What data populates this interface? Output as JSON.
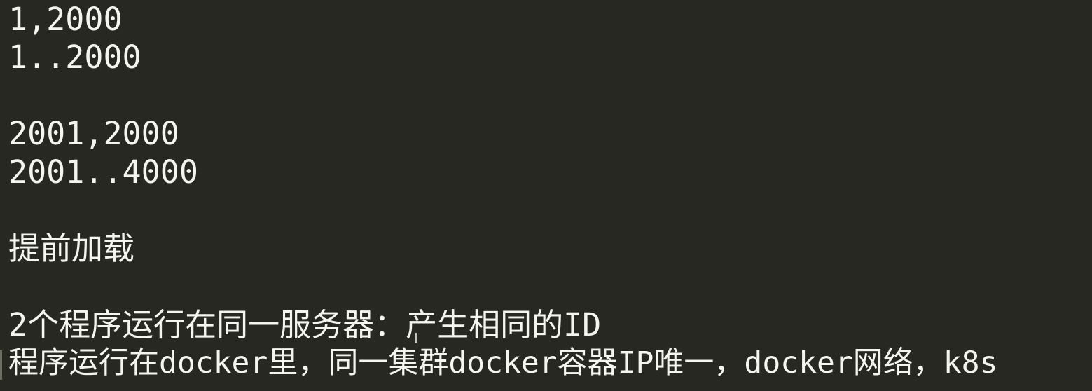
{
  "editor": {
    "lines": [
      "1,2000",
      "1..2000",
      "2001,2000",
      "2001..4000",
      "提前加载",
      "2个程序运行在同一服务器：产生相同的ID",
      "程序运行在docker里，同一集群docker容器IP唯一，docker网络，k8s"
    ]
  },
  "colors": {
    "background": "#272822",
    "text": "#f4f4f0"
  }
}
